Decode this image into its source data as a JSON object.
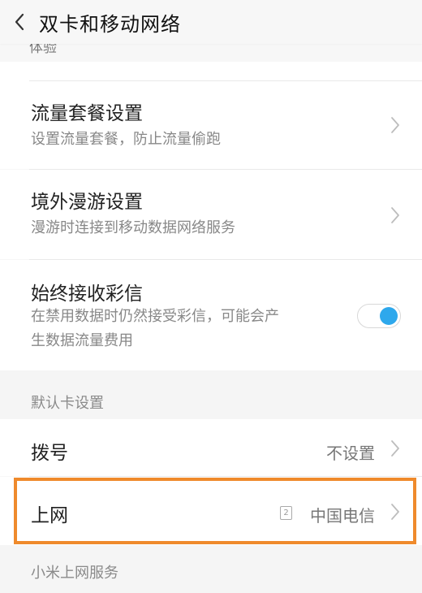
{
  "header": {
    "title": "双卡和移动网络"
  },
  "partial_top_text": "体验",
  "items": {
    "data_plan": {
      "title": "流量套餐设置",
      "subtitle": "设置流量套餐，防止流量偷跑"
    },
    "roaming": {
      "title": "境外漫游设置",
      "subtitle": "漫游时连接到移动数据网络服务"
    },
    "mms": {
      "title": "始终接收彩信",
      "subtitle_line1": "在禁用数据时仍然接受彩信，可能会产",
      "subtitle_line2": "生数据流量费用",
      "toggle_on": true
    }
  },
  "default_card_section": {
    "label": "默认卡设置",
    "dial": {
      "title": "拨号",
      "value": "不设置"
    },
    "internet": {
      "title": "上网",
      "sim_badge": "2",
      "value": "中国电信"
    }
  },
  "xiaomi_section": {
    "label": "小米上网服务"
  },
  "colors": {
    "toggle_knob": "#2ea8ec",
    "highlight_border": "#ef8a2c",
    "chevron": "#bdbdbd"
  }
}
